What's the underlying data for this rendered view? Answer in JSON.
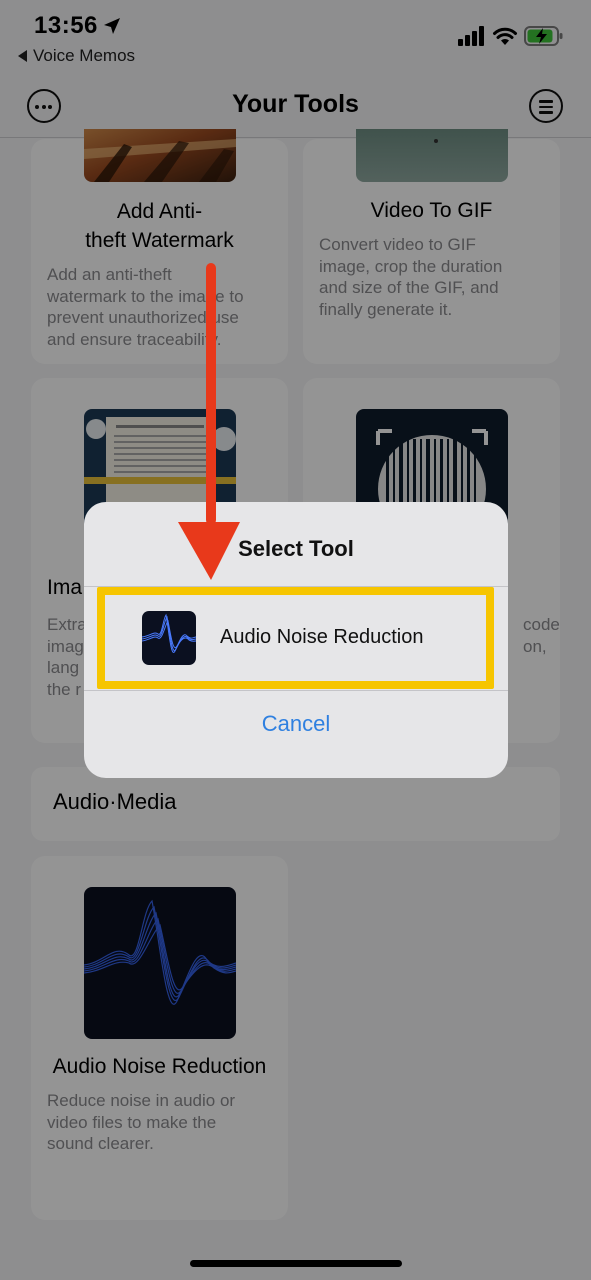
{
  "status_bar": {
    "time": "13:56",
    "back_app": "Voice Memos",
    "battery_color": "#3ec43a"
  },
  "nav": {
    "title": "Your Tools",
    "left_icon": "more-icon",
    "right_icon": "menu-icon"
  },
  "cards": {
    "watermark": {
      "title_line1": "Add Anti-",
      "title_line2": "theft Watermark",
      "desc_lines": [
        "Add an anti-theft",
        "watermark to the image to",
        "prevent unauthorized use",
        "and ensure traceability."
      ]
    },
    "video_gif": {
      "title": "Video To GIF",
      "desc_lines": [
        "Convert video to GIF",
        "image, crop the duration",
        "and size of the GIF, and",
        "finally generate it."
      ]
    },
    "image_text": {
      "title_fragment": "Ima",
      "desc_fragments": [
        "Extra",
        "imag",
        "lang",
        "the r"
      ]
    },
    "barcode": {
      "desc_fragments": [
        "code",
        "on,"
      ]
    },
    "audio_noise": {
      "title": "Audio Noise Reduction",
      "desc_lines": [
        "Reduce noise in audio or",
        "video files to make the",
        "sound clearer."
      ]
    }
  },
  "section": {
    "title": "Audio·Media"
  },
  "alert": {
    "title": "Select Tool",
    "option_label": "Audio Noise Reduction",
    "cancel_label": "Cancel"
  },
  "colors": {
    "highlight": "#f6c500",
    "arrow": "#e8391b",
    "link": "#2f80e0"
  }
}
